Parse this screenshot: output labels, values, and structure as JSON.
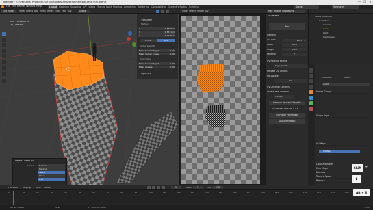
{
  "window": {
    "title": "Blender* [C:\\Personal Projects\\2023\\Tutorials\\ArtStationHairtool\\Test_002.blend]",
    "controls": [
      "—",
      "☐",
      "✕"
    ]
  },
  "menubar": {
    "items": [
      "File",
      "Edit",
      "Render",
      "Window",
      "Help"
    ],
    "workspaces": [
      "Layout",
      "Modeling",
      "Sculpting",
      "UV Editing",
      "Texture Paint",
      "Shading",
      "Animation",
      "Rendering",
      "Compositing",
      "Geometry Nodes",
      "Scripting"
    ],
    "active_workspace": "Layout",
    "scene": "Scene",
    "view_layer": "ViewLayer"
  },
  "viewport": {
    "mode": "Edit Mode",
    "menus": [
      "View",
      "Select",
      "Add",
      "Mesh",
      "Vertex",
      "Edge",
      "Face",
      "UV"
    ],
    "transform": "Global",
    "overlay_title": "User Perspective",
    "overlay_sub": "(3) CubeXX"
  },
  "npanel": {
    "transform_label": "Transform",
    "median_label": "Median:",
    "axes": [
      "X",
      "Y",
      "Z"
    ],
    "median_values": [
      "0.3396 m",
      "0.3711 m",
      "0.2215 m"
    ],
    "space_buttons": [
      "Global",
      "Local"
    ],
    "vertex_weights_label": "Vertex Weights",
    "vertex_weights": [
      {
        "label": "Mean Bevel Weight",
        "value": "0.00"
      },
      {
        "label": "Mean Vertex Crease",
        "value": "0.00"
      }
    ],
    "edge_data_label": "Edge Data",
    "edge_weights": [
      {
        "label": "Mean Bevel Weight",
        "value": "0.00"
      },
      {
        "label": "Mean Crease",
        "value": "0.00"
      }
    ],
    "properties_label": "Properties"
  },
  "uv_editor": {
    "menus": [
      "View",
      "Select",
      "Image",
      "UV"
    ],
    "image_name": "Hair_Image_Tutorial004"
  },
  "uv_sidebar": {
    "tab": "UV Packer",
    "run_button": "Run",
    "combine_label": "Combine",
    "uv_tiles_label": "UV Tiles",
    "tiles_value": "1001 / 1",
    "width_label": "Width",
    "width_value": "1024",
    "height_label": "Height",
    "height_value": "1024",
    "padding_label": "Padding",
    "padding_value": "2",
    "packing_engine_label": "UV Packing Engine",
    "quality": "High Quality",
    "rescale_label": "Rescale UV Chunks",
    "prerotate_label": "Pre-Rotate",
    "rotation": "90",
    "channel_controls_label": "UV Channel Controls",
    "channel_create": "Create new channel",
    "channel_value": "UVMap",
    "remove_channel": "Remove Unused Channels",
    "version_label": "UV-Packer Version 1.0.6",
    "homepage_button": "UV-Packer Homepage",
    "docs_button": "Documentation"
  },
  "outliner": {
    "title": "Scene Collection",
    "items": [
      "Collection",
      "Camera",
      "Cube",
      "Light",
      "HairCurves"
    ]
  },
  "properties": {
    "object_name": "CubeXXX",
    "mesh_name": "Cube",
    "sections": [
      "Vertex Groups",
      "Shape Keys",
      "UV Maps",
      "Attributes",
      "Normals",
      "Texture Space",
      "Remesh",
      "Geometry Data",
      "Custom Properties"
    ],
    "uv_map_item": "UVMap",
    "sub_sections": [
      "Color Attributes",
      "Face Maps"
    ]
  },
  "select_popup": {
    "title": "Select Linked All",
    "delimit_label": "Delimit",
    "options": [
      "Normal",
      "Material",
      "Seam",
      "Sharp",
      "UVs"
    ],
    "highlighted": [
      "Seam",
      "UVs"
    ]
  },
  "timeline": {
    "menus": [
      "Playback",
      "Keying",
      "View",
      "Marker"
    ],
    "frame_numbers": [
      "0",
      "10",
      "20",
      "30",
      "40",
      "50",
      "60",
      "70",
      "80",
      "90",
      "100",
      "110",
      "120",
      "130",
      "140",
      "150",
      "160",
      "170",
      "180",
      "190",
      "200",
      "210",
      "220",
      "230",
      "240",
      "250"
    ],
    "current_frame": "1",
    "start_label": "Start",
    "start": "1",
    "end_label": "End",
    "end": "250"
  },
  "statusbar": {
    "items": [
      "Set 3D Cursor",
      "Move",
      "UV Context Menu"
    ],
    "version": "3.5.1"
  },
  "keys": {
    "shift": "Shift",
    "plus": "+",
    "l": "L",
    "alt_6": "Alt + 6"
  },
  "colors": {
    "accent": "#4772b3",
    "selected_orange": "#ff8a1c",
    "header_bg": "#2a2a2a",
    "uv_checker_dark": "#6e6e6e",
    "uv_checker_light": "#9a9a9a"
  }
}
